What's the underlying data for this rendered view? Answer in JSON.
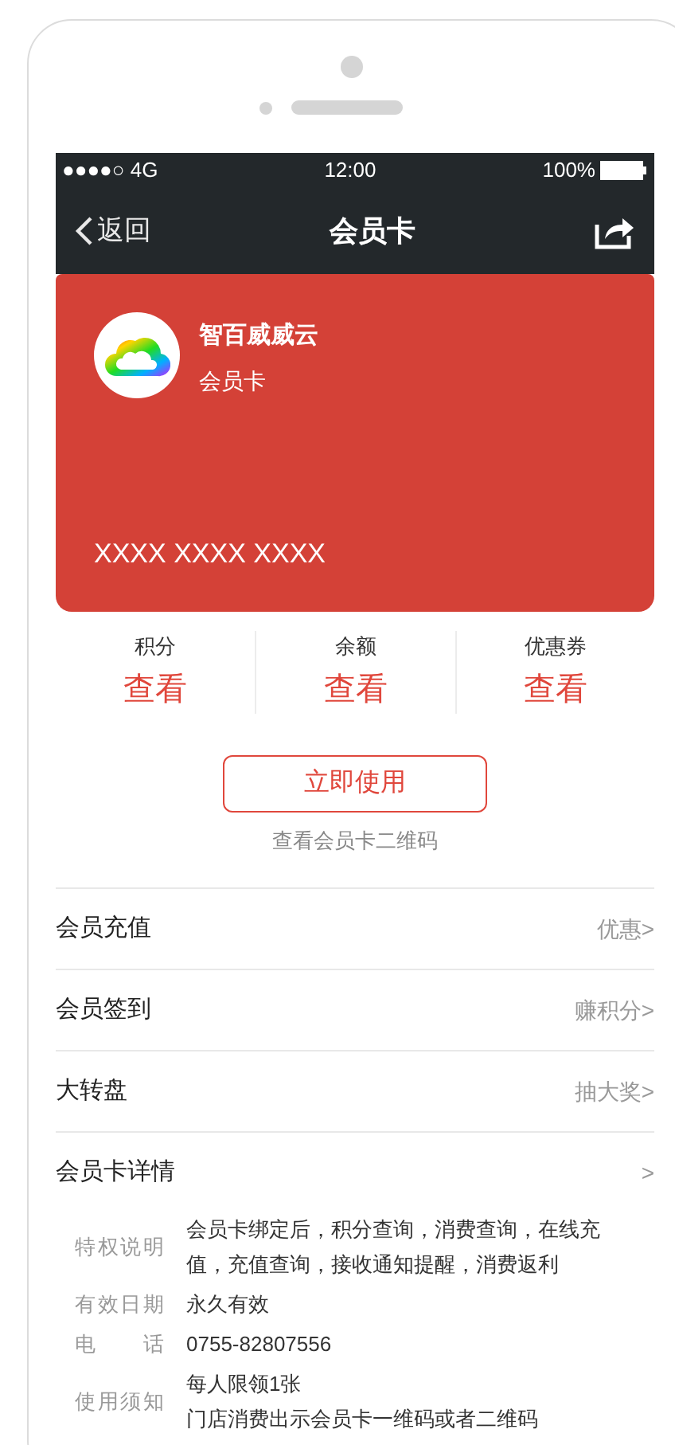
{
  "status_bar": {
    "signal": "●●●●○ 4G",
    "time": "12:00",
    "battery": "100%"
  },
  "nav": {
    "back": "返回",
    "title": "会员卡"
  },
  "card": {
    "brand": "智百威威云",
    "subtitle": "会员卡",
    "number": "XXXX XXXX XXXX"
  },
  "stats": [
    {
      "label": "积分",
      "value": "查看"
    },
    {
      "label": "余额",
      "value": "查看"
    },
    {
      "label": "优惠券",
      "value": "查看"
    }
  ],
  "use_button": "立即使用",
  "qr_link": "查看会员卡二维码",
  "menu": [
    {
      "label": "会员充值",
      "hint": "优惠>"
    },
    {
      "label": "会员签到",
      "hint": "赚积分>"
    },
    {
      "label": "大转盘",
      "hint": "抽大奖>"
    },
    {
      "label": "会员卡详情",
      "hint": ">"
    }
  ],
  "details": [
    {
      "label": "特权说明",
      "lines": [
        "会员卡绑定后，积分查询，消费查询，在线充值，充值查询，接收通知提醒，消费返利"
      ]
    },
    {
      "label": "有效日期",
      "lines": [
        "永久有效"
      ]
    },
    {
      "label": "电话",
      "lines": [
        "0755-82807556"
      ]
    },
    {
      "label": "使用须知",
      "lines": [
        "每人限领1张",
        "门店消费出示会员卡一维码或者二维码"
      ]
    }
  ]
}
